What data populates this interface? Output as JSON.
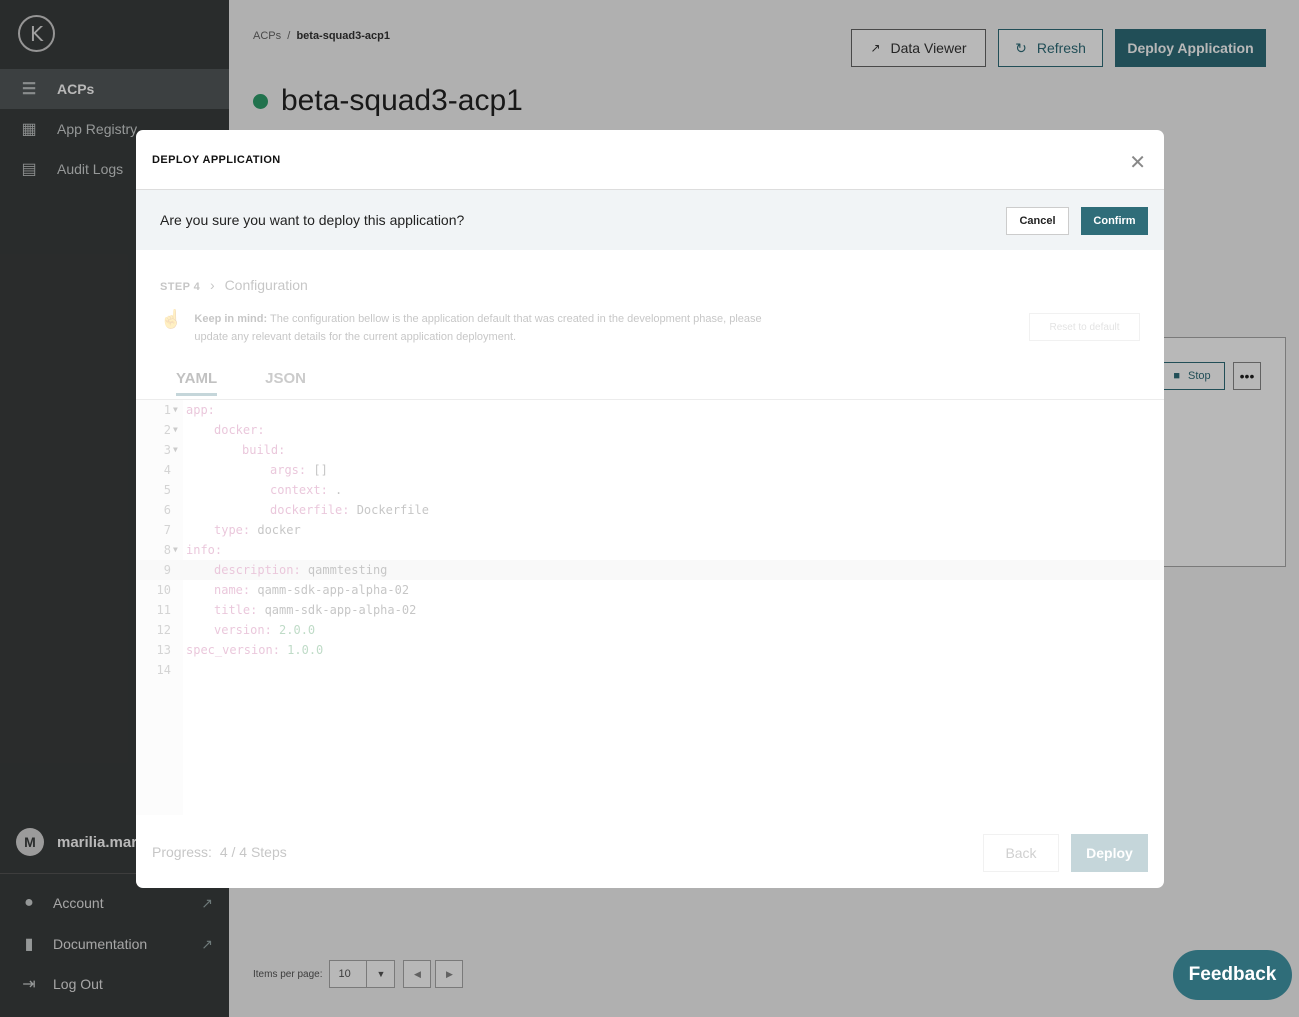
{
  "sidebar": {
    "logo": "K",
    "items": [
      {
        "label": "ACPs",
        "icon": "server-icon"
      },
      {
        "label": "App Registry",
        "icon": "grid-icon"
      },
      {
        "label": "Audit Logs",
        "icon": "clipboard-icon"
      }
    ],
    "user": {
      "initial": "M",
      "name": "marilia.mar"
    },
    "footer": [
      {
        "label": "Account",
        "icon": "user-circle-icon"
      },
      {
        "label": "Documentation",
        "icon": "document-icon"
      },
      {
        "label": "Log Out",
        "icon": "logout-icon"
      }
    ]
  },
  "page": {
    "breadcrumb": {
      "root": "ACPs",
      "separator": "/",
      "current": "beta-squad3-acp1"
    },
    "title": "beta-squad3-acp1",
    "buttons": {
      "data_viewer": "Data Viewer",
      "refresh": "Refresh",
      "deploy": "Deploy Application"
    },
    "stop": "Stop",
    "pager": {
      "label": "Items per page:",
      "value": "10"
    }
  },
  "modal": {
    "title": "DEPLOY APPLICATION",
    "confirm_question": "Are you sure you want to deploy this application?",
    "cancel": "Cancel",
    "confirm": "Confirm",
    "step_label": "STEP 4",
    "step_name": "Configuration",
    "keep_title": "Keep in mind:",
    "keep_text": "The configuration bellow is the application default that was created in the development phase, please update any relevant details for the current application deployment.",
    "reset": "Reset to default",
    "tabs": [
      "YAML",
      "JSON"
    ],
    "code_lines": [
      {
        "n": "1",
        "fold": true,
        "indent": 0,
        "key": "app:",
        "val": ""
      },
      {
        "n": "2",
        "fold": true,
        "indent": 1,
        "key": "docker:",
        "val": ""
      },
      {
        "n": "3",
        "fold": true,
        "indent": 2,
        "key": "build:",
        "val": ""
      },
      {
        "n": "4",
        "fold": false,
        "indent": 3,
        "key": "args:",
        "val": " []"
      },
      {
        "n": "5",
        "fold": false,
        "indent": 3,
        "key": "context:",
        "val": " ."
      },
      {
        "n": "6",
        "fold": false,
        "indent": 3,
        "key": "dockerfile:",
        "val": " Dockerfile"
      },
      {
        "n": "7",
        "fold": false,
        "indent": 1,
        "key": "type:",
        "val": " docker"
      },
      {
        "n": "8",
        "fold": true,
        "indent": 0,
        "key": "info:",
        "val": ""
      },
      {
        "n": "9",
        "fold": false,
        "indent": 1,
        "key": "description:",
        "val": " qammtesting"
      },
      {
        "n": "10",
        "fold": false,
        "indent": 1,
        "key": "name:",
        "val": " qamm-sdk-app-alpha-02"
      },
      {
        "n": "11",
        "fold": false,
        "indent": 1,
        "key": "title:",
        "val": " qamm-sdk-app-alpha-02"
      },
      {
        "n": "12",
        "fold": false,
        "indent": 1,
        "key": "version:",
        "val": " 2.0.0"
      },
      {
        "n": "13",
        "fold": false,
        "indent": 0,
        "key": "spec_version:",
        "val": " 1.0.0"
      },
      {
        "n": "14",
        "fold": false,
        "indent": 0,
        "key": "",
        "val": ""
      }
    ],
    "progress_label": "Progress:",
    "progress_value": "4 / 4 Steps",
    "back": "Back",
    "deploy": "Deploy"
  },
  "feedback": "Feedback",
  "colors": {
    "accent": "#2f6d79",
    "status": "#2f9e6b",
    "sidebar": "#3a3d3d"
  }
}
